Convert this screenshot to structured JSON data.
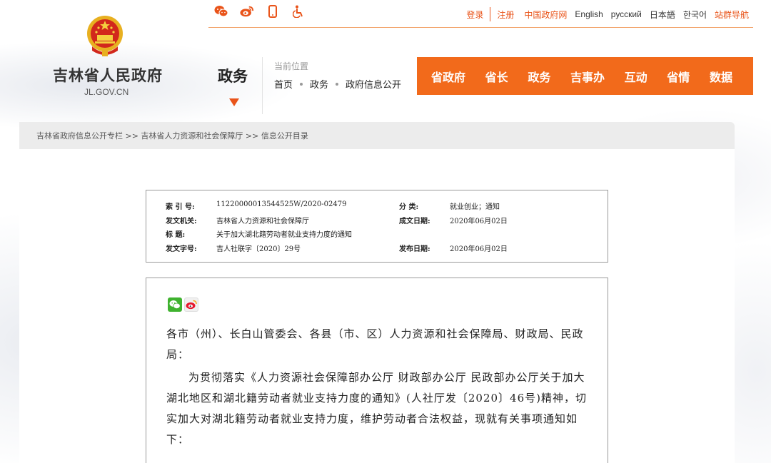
{
  "header": {
    "icons": [
      "wechat-icon",
      "weibo-icon",
      "mobile-icon",
      "accessibility-icon"
    ],
    "links": {
      "login": "登录",
      "register": "注册",
      "gov": "中国政府网",
      "english": "English",
      "russian": "русский",
      "japanese": "日本語",
      "korean": "한국어",
      "site_nav": "站群导航"
    },
    "site_name": "吉林省人民政府",
    "site_url": "JL.GOV.CN",
    "section_title": "政务",
    "location_label": "当前位置",
    "crumbs": [
      "首页",
      "政务",
      "政府信息公开"
    ]
  },
  "nav": [
    "省政府",
    "省长",
    "政务",
    "吉事办",
    "互动",
    "省情",
    "数据"
  ],
  "band": {
    "path": "吉林省政府信息公开专栏 >> 吉林省人力资源和社会保障厅 >> 信息公开目录"
  },
  "meta": {
    "index_label": "索 引 号:",
    "index_value": "11220000013544525W/2020-02479",
    "category_label": "分    类:",
    "category_value": "就业创业；通知",
    "issuer_label": "发文机关:",
    "issuer_value": "吉林省人力资源和社会保障厅",
    "date_written_label": "成文日期:",
    "date_written_value": "2020年06月02日",
    "title_label": "标    题:",
    "title_value": "关于加大湖北籍劳动者就业支持力度的通知",
    "doc_no_label": "发文字号:",
    "doc_no_value": "吉人社联字〔2020〕29号",
    "publish_label": "发布日期:",
    "publish_value": "2020年06月02日"
  },
  "article": {
    "salutation": "各市（州）、长白山管委会、各县（市、区）人力资源和社会保障局、财政局、民政局：",
    "paragraph1": "为贯彻落实《人力资源社会保障部办公厅  财政部办公厅  民政部办公厅关于加大湖北地区和湖北籍劳动者就业支持力度的通知》(人社厅发〔2020〕46号)精神，切实加大对湖北籍劳动者就业支持力度，维护劳动者合法权益，现就有关事项通知如下："
  },
  "colors": {
    "accent": "#f26a1b",
    "link_orange": "#e9541a",
    "band_grey": "#ececec"
  }
}
